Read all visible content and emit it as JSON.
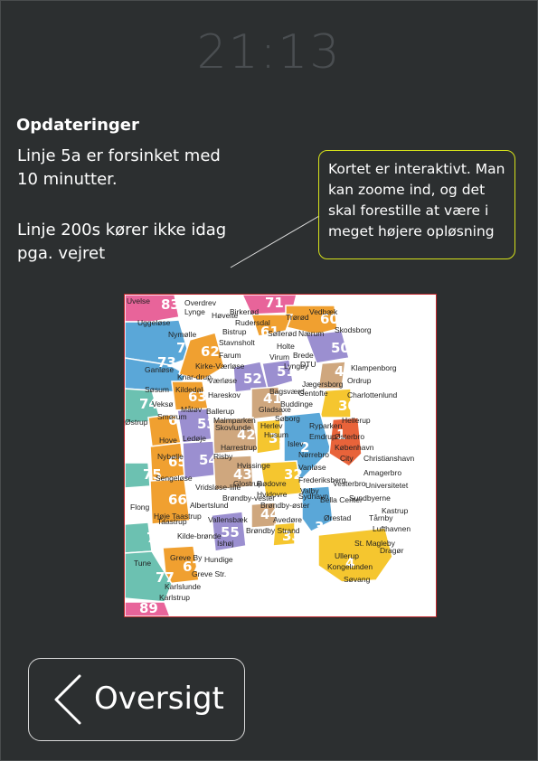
{
  "clock": {
    "time": "21:13"
  },
  "updates": {
    "title": "Opdateringer",
    "messages": [
      "Linje 5a er forsinket med 10 minutter.",
      "Linje 200s kører ikke idag pga. vejret"
    ]
  },
  "note": {
    "text": "Kortet er interaktivt. Man kan zoome ind, og  det skal forestille at være i meget højere opløsning"
  },
  "map": {
    "zones": [
      {
        "label": "83",
        "color": "#e8649a"
      },
      {
        "label": "71",
        "color": "#e8649a"
      },
      {
        "label": "60",
        "color": "#f0a030"
      },
      {
        "label": "72",
        "color": "#5aa7d8"
      },
      {
        "label": "61",
        "color": "#f0a030"
      },
      {
        "label": "50",
        "color": "#9b8fd0"
      },
      {
        "label": "73",
        "color": "#5aa7d8"
      },
      {
        "label": "62",
        "color": "#f0a030"
      },
      {
        "label": "52",
        "color": "#9b8fd0"
      },
      {
        "label": "51",
        "color": "#9b8fd0"
      },
      {
        "label": "40",
        "color": "#cfa77e"
      },
      {
        "label": "74",
        "color": "#6cc1b1"
      },
      {
        "label": "63",
        "color": "#f0a030"
      },
      {
        "label": "41",
        "color": "#cfa77e"
      },
      {
        "label": "30",
        "color": "#f5c62f"
      },
      {
        "label": "64",
        "color": "#f0a030"
      },
      {
        "label": "53",
        "color": "#9b8fd0"
      },
      {
        "label": "42",
        "color": "#cfa77e"
      },
      {
        "label": "31",
        "color": "#f5c62f"
      },
      {
        "label": "2",
        "color": "#5aa7d8"
      },
      {
        "label": "1",
        "color": "#e8633a"
      },
      {
        "label": "65",
        "color": "#f0a030"
      },
      {
        "label": "75",
        "color": "#6cc1b1"
      },
      {
        "label": "54",
        "color": "#9b8fd0"
      },
      {
        "label": "43",
        "color": "#cfa77e"
      },
      {
        "label": "32",
        "color": "#f5c62f"
      },
      {
        "label": "66",
        "color": "#f0a030"
      },
      {
        "label": "44",
        "color": "#cfa77e"
      },
      {
        "label": "33",
        "color": "#f5c62f"
      },
      {
        "label": "3",
        "color": "#5aa7d8"
      },
      {
        "label": "76",
        "color": "#6cc1b1"
      },
      {
        "label": "55",
        "color": "#9b8fd0"
      },
      {
        "label": "4",
        "color": "#f5c62f"
      },
      {
        "label": "67",
        "color": "#f0a030"
      },
      {
        "label": "77",
        "color": "#6cc1b1"
      },
      {
        "label": "89",
        "color": "#e8649a"
      }
    ],
    "places": [
      "Uvelse",
      "Lynge",
      "Overdrev",
      "Høvelte",
      "Birkerød",
      "Vedbæk",
      "Uggeløse",
      "Rudersdal",
      "Trørød",
      "Nymølle",
      "Bistrup",
      "Søllerød",
      "Nærum",
      "Skodsborg",
      "Stavnsholt",
      "Holte",
      "Farum",
      "Brede",
      "Ganløse",
      "Kirke-Værløse",
      "DTU",
      "Knar-drup",
      "Virum",
      "Lyngby",
      "Klampenborg",
      "Søsum",
      "Kildedal",
      "Værløse",
      "Jægersborg",
      "Ordrup",
      "Hareskov",
      "Bagsværd",
      "Gentofte",
      "Charlottenlund",
      "Veksø",
      "Måløv",
      "Buddinge",
      "Smørum",
      "Ballerup",
      "Gladsaxe",
      "Hellerup",
      "Østrup",
      "Malmparken",
      "Søborg",
      "Hove",
      "Skovlunde",
      "Herlev",
      "Ryparken",
      "Ledøje",
      "Husum",
      "Emdrup",
      "Østerbro",
      "Harrestrup",
      "Islev",
      "København",
      "Nybølle",
      "City",
      "Nørrebro",
      "Christianshavn",
      "Sengeløse",
      "Risby",
      "Hvissinge",
      "Vanløse",
      "Amagerbro",
      "Frederiksberg",
      "Universitetet",
      "Vridsløse-lille",
      "Glostrup",
      "Rødovre",
      "Valby",
      "Vesterbro",
      "Sundbyerne",
      "Albertslund",
      "Brøndby-vester",
      "Hvidovre",
      "Brøndby-øster",
      "Sydhavn",
      "Flong",
      "Høje Taastrup",
      "Bella Center",
      "Kastrup",
      "Taastrup",
      "Vallensbæk",
      "Avedøre",
      "Ørestad",
      "Tårnby",
      "Brøndby Strand",
      "Lufthavnen",
      "Kilde-brønde",
      "Ishøj",
      "St. Magleby",
      "Dragør",
      "Greve By",
      "Hundige",
      "Ullerup",
      "Kongelunden",
      "Tune",
      "Greve Str.",
      "Søvang",
      "Karlslunde",
      "Karlstrup"
    ]
  },
  "back_button": {
    "label": "Oversigt"
  },
  "colors": {
    "background": "#2c2f30",
    "clock": "#4a4e51",
    "note_border": "#d6e21b",
    "map_border": "#c0282d"
  }
}
